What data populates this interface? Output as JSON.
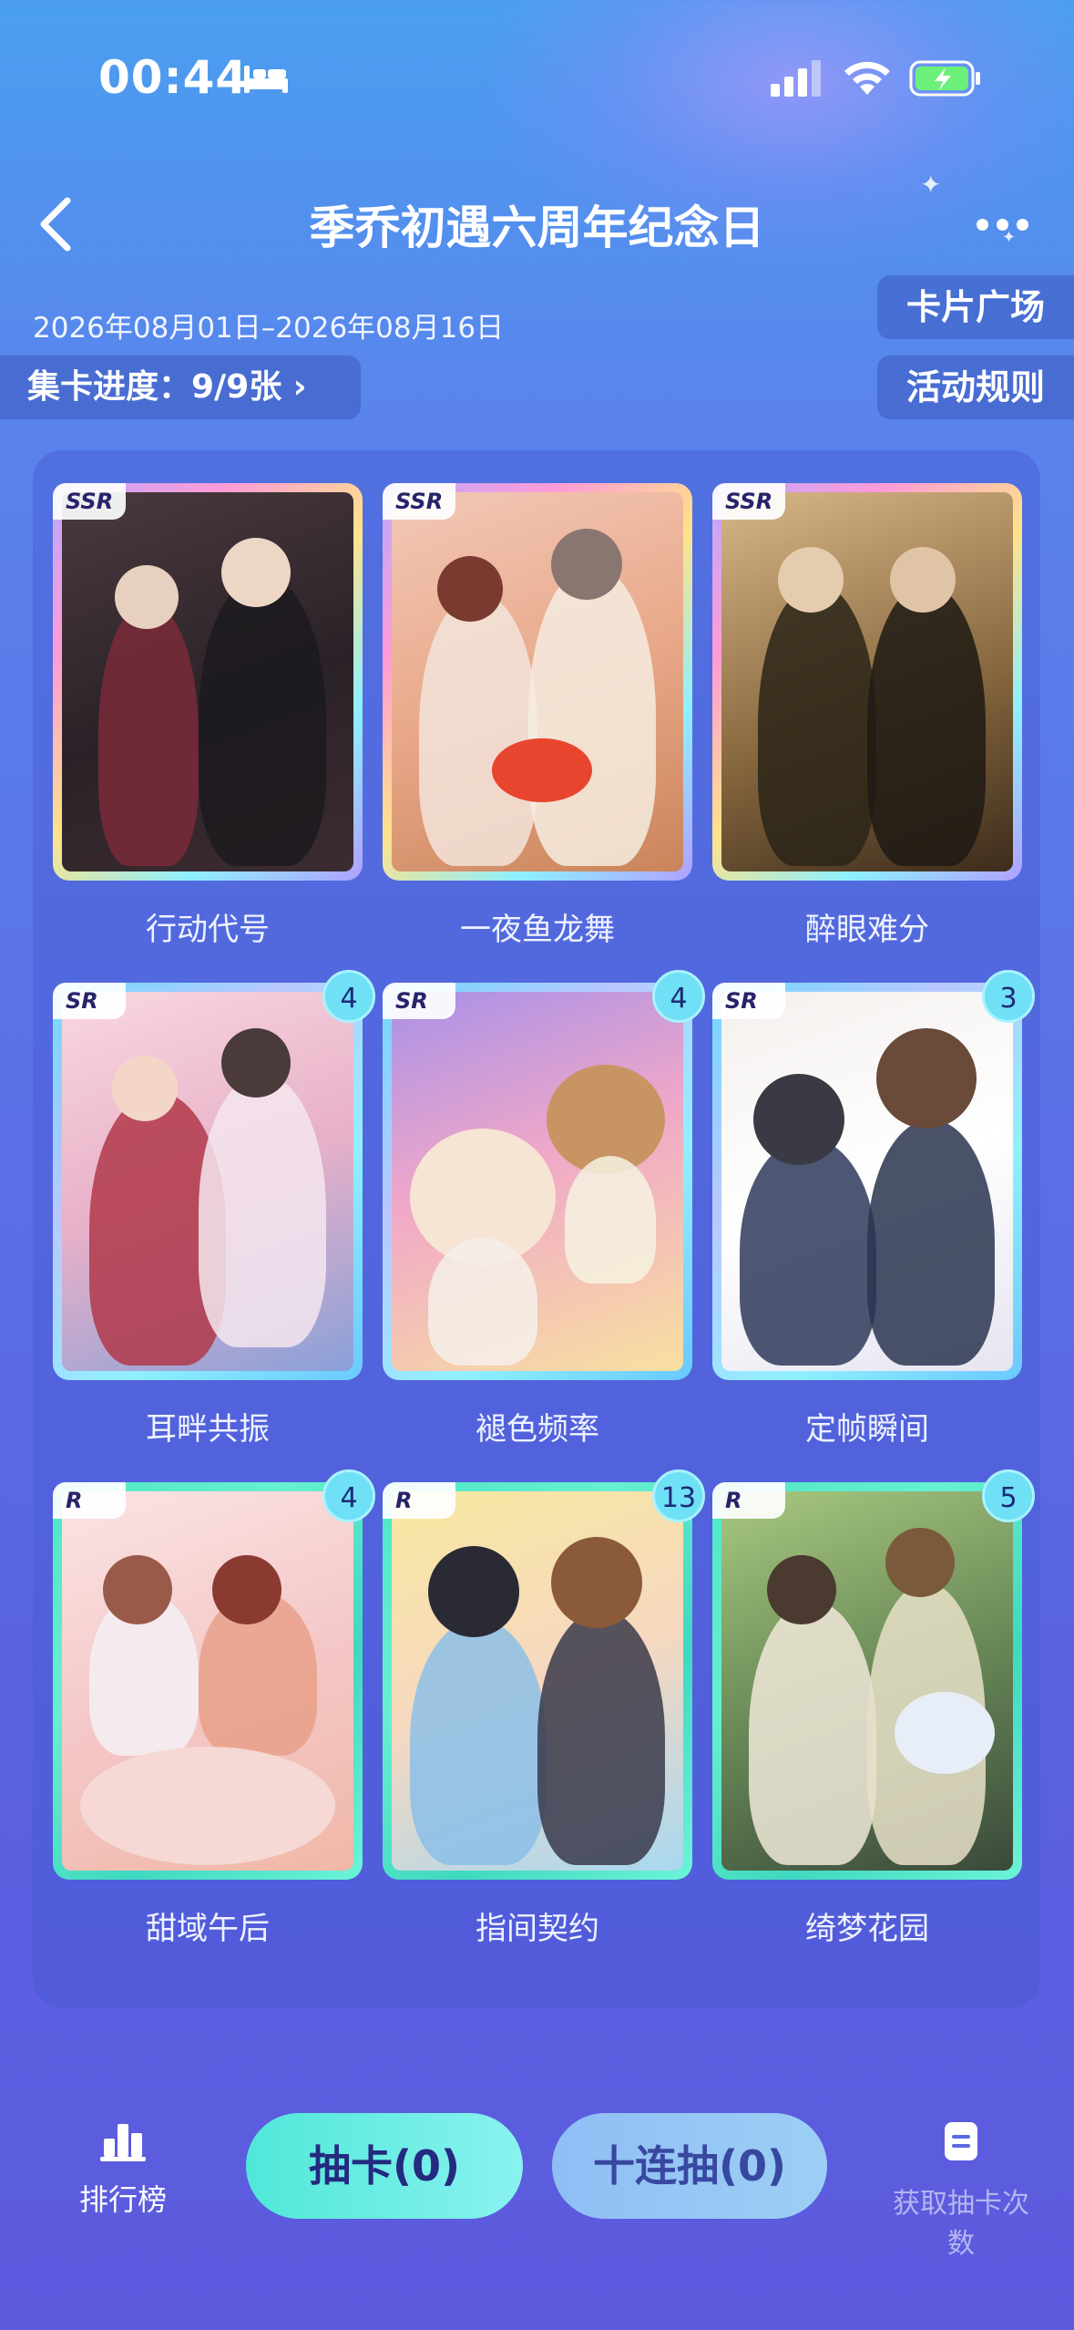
{
  "status_bar": {
    "time": "00:44"
  },
  "header": {
    "title": "季乔初遇六周年纪念日",
    "date_range": "2026年08月01日–2026年08月16日",
    "progress_label": "集卡进度：9/9张 ›",
    "plaza_label": "卡片广场",
    "rules_label": "活动规则"
  },
  "cards": [
    {
      "name": "行动代号",
      "rarity": "SSR",
      "count": ""
    },
    {
      "name": "一夜鱼龙舞",
      "rarity": "SSR",
      "count": ""
    },
    {
      "name": "醉眼难分",
      "rarity": "SSR",
      "count": ""
    },
    {
      "name": "耳畔共振",
      "rarity": "SR",
      "count": "4"
    },
    {
      "name": "褪色频率",
      "rarity": "SR",
      "count": "4"
    },
    {
      "name": "定帧瞬间",
      "rarity": "SR",
      "count": "3"
    },
    {
      "name": "甜域午后",
      "rarity": "R",
      "count": "4"
    },
    {
      "name": "指间契约",
      "rarity": "R",
      "count": "13"
    },
    {
      "name": "绮梦花园",
      "rarity": "R",
      "count": "5"
    }
  ],
  "bottom_bar": {
    "rank_label": "排行榜",
    "draw_label": "抽卡(0)",
    "ten_draw_label": "十连抽(0)",
    "doc_label": "获取抽卡次数"
  },
  "colors": {
    "accent_teal": "#4fe8d8",
    "background_blue": "#5a6fe6"
  }
}
